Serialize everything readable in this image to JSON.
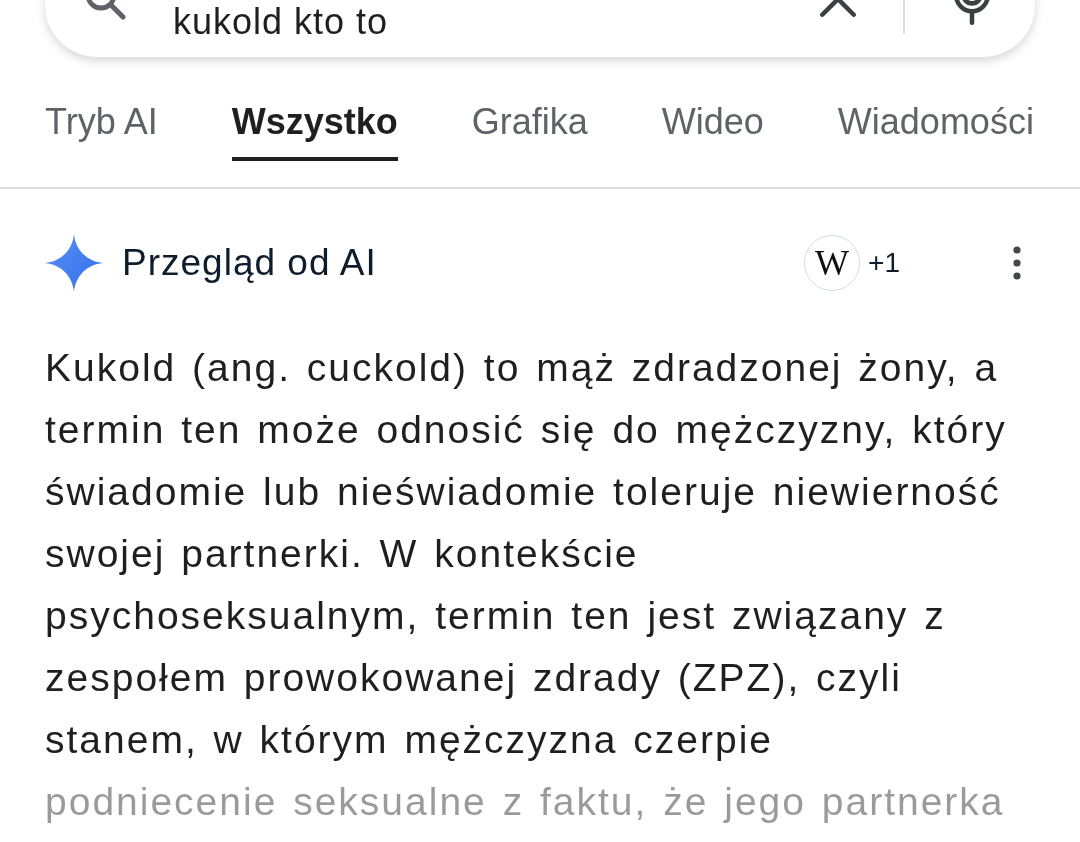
{
  "search": {
    "value": "kukold kto to"
  },
  "tabs": [
    {
      "label": "Tryb AI",
      "selected": false
    },
    {
      "label": "Wszystko",
      "selected": true
    },
    {
      "label": "Grafika",
      "selected": false
    },
    {
      "label": "Wideo",
      "selected": false
    },
    {
      "label": "Wiadomości",
      "selected": false
    }
  ],
  "ai_overview": {
    "title": "Przegląd od AI",
    "sources": {
      "logo_text": "W",
      "count": "+1"
    },
    "text": "Kukold (ang. cuckold) to mąż zdradzonej żony, a termin ten może odnosić się do mężczyzny, który świadomie lub nieświadomie toleruje niewierność swojej partnerki. W kontekście psychoseksualnym, termin ten jest związany z zespołem prowokowanej zdrady (ZPZ), czyli stanem, w którym mężczyzna czerpie podniecenie seksualne z faktu, że jego partnerka"
  }
}
